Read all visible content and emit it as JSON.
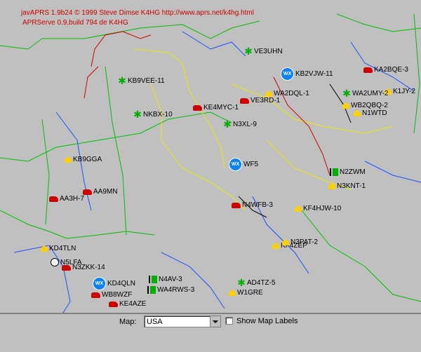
{
  "app": {
    "credit_line_1": "javAPRS 1.9b24 © 1999 Steve Dimse K4HG http://www.aprs.net/k4hg.html",
    "credit_line_2": "APRServe 0.9,build 794 de K4HG"
  },
  "controls": {
    "map_label": "Map:",
    "map_selected": "USA",
    "show_labels_label": "Show Map Labels",
    "show_labels_checked": false
  },
  "stations": [
    {
      "call": "VE3UHN",
      "kind": "star"
    },
    {
      "call": "KB9VEE-11",
      "kind": "star"
    },
    {
      "call": "WA2DQL-1",
      "kind": "house"
    },
    {
      "call": "VE3RD-1",
      "kind": "car"
    },
    {
      "call": "KB2VJW-11",
      "kind": "wx"
    },
    {
      "call": "KA2BQE-3",
      "kind": "car"
    },
    {
      "call": "K1JY-2",
      "kind": "house"
    },
    {
      "call": "WA2UMY-2",
      "kind": "star"
    },
    {
      "call": "WB2QBQ-2",
      "kind": "house"
    },
    {
      "call": "N3KNT-1",
      "kind": "house"
    },
    {
      "call": "NKBX-10",
      "kind": "star"
    },
    {
      "call": "AA9MN",
      "kind": "car"
    },
    {
      "call": "AA3H-7",
      "kind": "car"
    },
    {
      "call": "N3XL-9",
      "kind": "star"
    },
    {
      "call": "N4WFB-3",
      "kind": "car"
    },
    {
      "call": "KF4HJW-10",
      "kind": "house"
    },
    {
      "call": "N3ZKK-14",
      "kind": "car"
    },
    {
      "call": "N5LFA",
      "kind": "dgt"
    },
    {
      "call": "KD4TLN",
      "kind": "house"
    },
    {
      "call": "KD4QLN",
      "kind": "wx"
    },
    {
      "call": "KF4ZEP",
      "kind": "house"
    },
    {
      "call": "AD4TZ-5",
      "kind": "star"
    },
    {
      "call": "W1GRE",
      "kind": "house"
    },
    {
      "call": "WA4RWS-3",
      "kind": "flag"
    },
    {
      "call": "N4AV-3",
      "kind": "flag"
    },
    {
      "call": "KE4AZE",
      "kind": "car"
    },
    {
      "call": "WB8WZF",
      "kind": "car"
    },
    {
      "call": "WF5",
      "kind": "wx"
    },
    {
      "call": "N3PAT-2",
      "kind": "house"
    },
    {
      "call": "KB9GGA",
      "kind": "house"
    },
    {
      "call": "KE4MYC-1",
      "kind": "car"
    },
    {
      "call": "N1WTD",
      "kind": "house"
    },
    {
      "call": "N2ZWM",
      "kind": "flag"
    }
  ],
  "icons": {
    "wx": "weather-station-icon",
    "star": "digipeater-star-icon",
    "house": "home-station-icon",
    "car": "car-icon",
    "dgt": "digi-node-icon",
    "flag": "flag-icon"
  },
  "colors": {
    "map_background": "#c0c0c0",
    "county_lines_blue": "#1e50ff",
    "state_lines_green": "#00c000",
    "state_lines_yellow": "#e8e800",
    "state_lines_red": "#d00000",
    "credit_text": "#cc0000"
  }
}
